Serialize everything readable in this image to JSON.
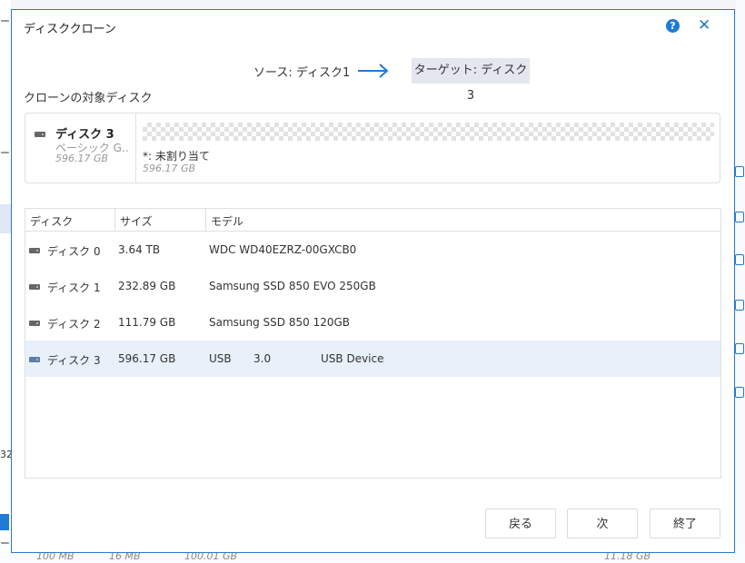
{
  "dialog": {
    "title": "ディスククローン",
    "help_label": "?",
    "close_label": "✕"
  },
  "direction": {
    "source": "ソース: ディスク1",
    "target": "ターゲット: ディスク3"
  },
  "section_label": "クローンの対象ディスク",
  "target_disk": {
    "name": "ディスク 3",
    "type": "ベーシック G‥",
    "size": "596.17 GB",
    "partition_label": "*: 未割り当て",
    "partition_size": "596.17 GB"
  },
  "table": {
    "headers": [
      "ディスク",
      "サイズ",
      "モデル"
    ],
    "rows": [
      {
        "disk": "ディスク 0",
        "size": "3.64 TB",
        "model": "WDC WD40EZRZ-00GXCB0",
        "selected": false
      },
      {
        "disk": "ディスク 1",
        "size": "232.89 GB",
        "model": "Samsung SSD 850 EVO 250GB",
        "selected": false
      },
      {
        "disk": "ディスク 2",
        "size": "111.79 GB",
        "model": "Samsung SSD 850 120GB",
        "selected": false
      },
      {
        "disk": "ディスク 3",
        "size": "596.17 GB",
        "model": "USB",
        "model_extra1": "3.0",
        "model_extra2": "USB Device",
        "selected": true
      }
    ]
  },
  "buttons": {
    "back": "戻る",
    "next": "次",
    "finish": "終了"
  },
  "background": {
    "left_texts": [
      "ー",
      "ー",
      "32",
      "ー"
    ],
    "bottom_values": [
      "100 MB",
      "16 MB",
      "100.01 GB",
      "11.18 GB"
    ]
  },
  "colors": {
    "accent": "#1e7bd6",
    "selected_row": "#e8f0f9",
    "target_chip": "#e4e7ef"
  },
  "icons": [
    "help-icon",
    "close-icon",
    "arrow-right-icon",
    "drive-icon"
  ]
}
